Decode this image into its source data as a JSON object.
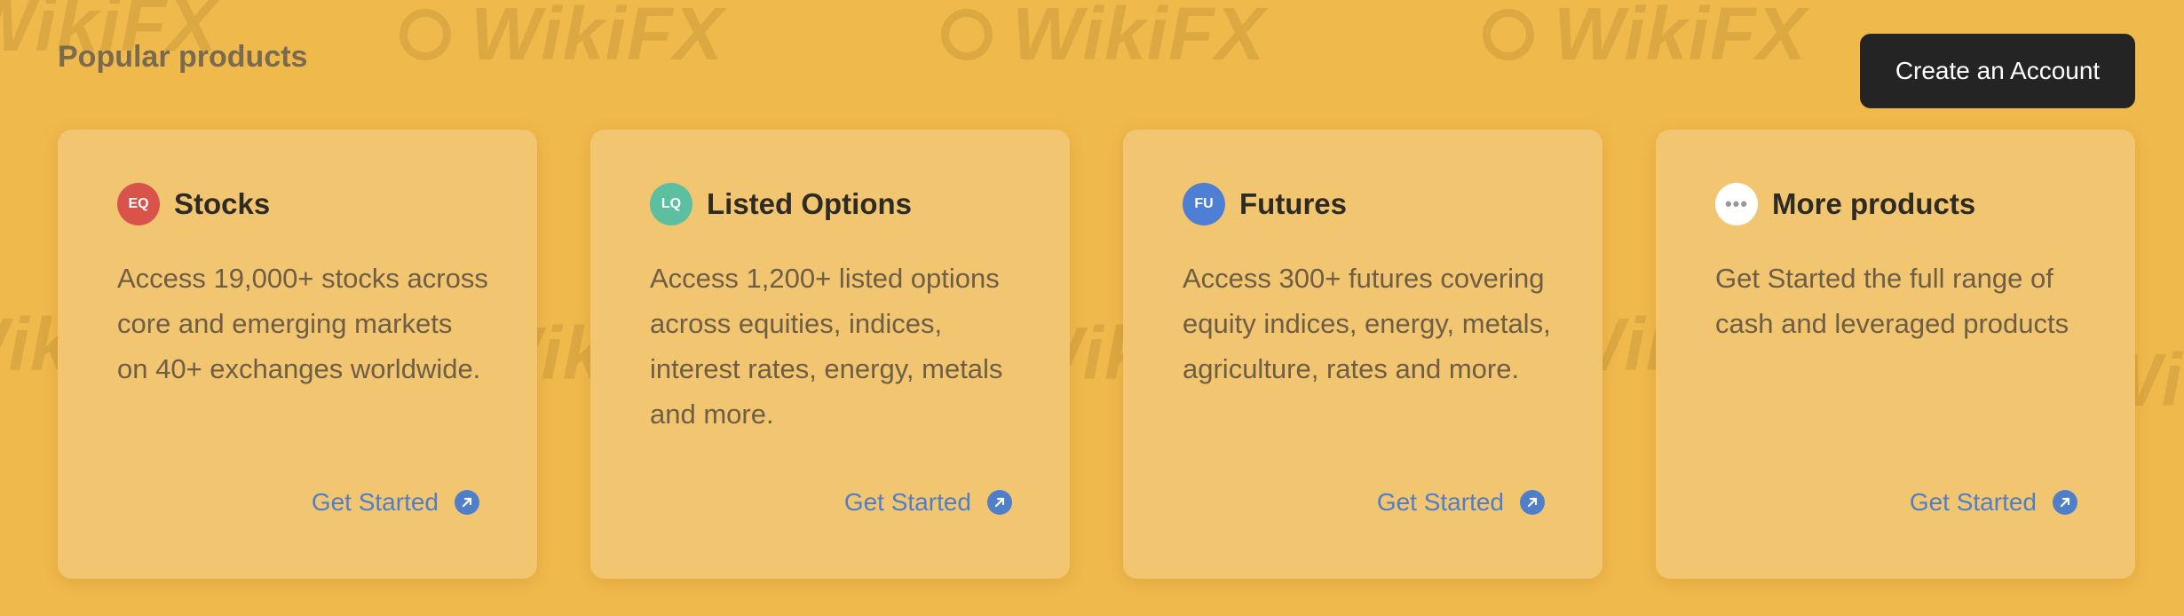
{
  "section_title": "Popular products",
  "cta_label": "Create an Account",
  "watermark_text": "WikiFX",
  "cards": [
    {
      "badge": "EQ",
      "badge_color": "#d9534a",
      "title": "Stocks",
      "description": "Access 19,000+ stocks across core and emerging markets on 40+ exchanges worldwide.",
      "link": "Get Started"
    },
    {
      "badge": "LQ",
      "badge_color": "#5cbfa0",
      "title": "Listed Options",
      "description": "Access 1,200+ listed options across equities, indices, interest rates, energy, metals and more.",
      "link": "Get Started"
    },
    {
      "badge": "FU",
      "badge_color": "#4f7fd4",
      "title": "Futures",
      "description": "Access 300+ futures covering equity indices, energy, metals, agriculture, rates and more.",
      "link": "Get Started"
    },
    {
      "badge": "•••",
      "badge_color": "#ffffff",
      "title": "More products",
      "description": "Get Started the full range of cash and leveraged products",
      "link": "Get Started"
    }
  ],
  "colors": {
    "background": "#f0b94c",
    "card": "#f2c570",
    "link": "#4f7fc9",
    "cta_bg": "#242424"
  }
}
